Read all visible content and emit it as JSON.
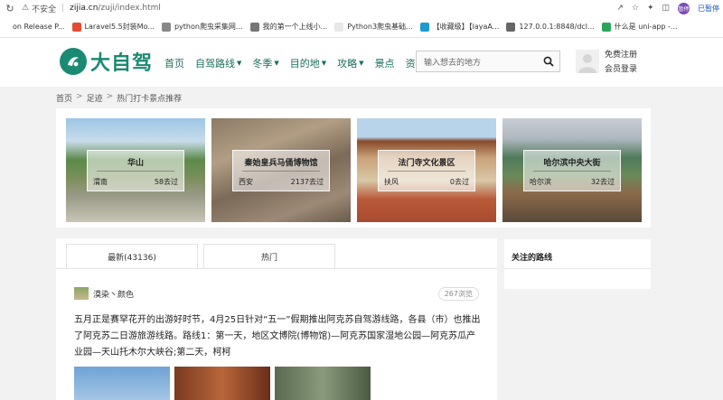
{
  "browser": {
    "security": "不安全",
    "url_host": "zijia.cn",
    "url_path": "/zuji/index.html",
    "account_label": "已暂停",
    "account_chip": "暂停"
  },
  "bookmarks": [
    {
      "label": "on Release P...",
      "color": "#ffffff"
    },
    {
      "label": "Laravel5.5封装Mo...",
      "color": "#e64a32"
    },
    {
      "label": "python爬虫采集网...",
      "color": "#888888"
    },
    {
      "label": "我的第一个上线小...",
      "color": "#777777"
    },
    {
      "label": "Python3爬虫基础...",
      "color": "#e8e8e8"
    },
    {
      "label": "【收藏级】【layaA...",
      "color": "#1d9bd1"
    },
    {
      "label": "127.0.0.1:8848/dcl...",
      "color": "#666666"
    },
    {
      "label": "什么是 uni-app -...",
      "color": "#2aa65b"
    }
  ],
  "header": {
    "logo_text": "大自驾",
    "nav": [
      {
        "label": "首页",
        "dropdown": false
      },
      {
        "label": "自驾路线",
        "dropdown": true
      },
      {
        "label": "冬季",
        "dropdown": true
      },
      {
        "label": "目的地",
        "dropdown": true
      },
      {
        "label": "攻略",
        "dropdown": true
      },
      {
        "label": "景点",
        "dropdown": false
      },
      {
        "label": "资讯",
        "dropdown": false
      }
    ],
    "search_placeholder": "输入想去的地方",
    "register": "免费注册",
    "login": "会员登录"
  },
  "breadcrumb": [
    "首页",
    "足迹",
    "热门打卡景点推荐"
  ],
  "spots": [
    {
      "name": "华山",
      "city": "渭南",
      "visits": "58去过"
    },
    {
      "name": "秦始皇兵马俑博物馆",
      "city": "西安",
      "visits": "2137去过"
    },
    {
      "name": "法门寺文化景区",
      "city": "扶风",
      "visits": "0去过"
    },
    {
      "name": "哈尔滨中央大街",
      "city": "哈尔滨",
      "visits": "32去过"
    }
  ],
  "feed": {
    "tabs": [
      "最新(43136)",
      "热门"
    ],
    "post": {
      "author": "漠染丶颜色",
      "views": "267浏览",
      "text": "五月正是赛罕花开的出游好时节，4月25日针对“五一”假期推出阿克苏自驾游线路，各县（市）也推出了阿克苏二日游旅游线路。路线1：第一天，地区文博院(博物馆)—阿克苏国家湿地公园—阿克苏瓜产业园—天山托木尔大峡谷;第二天，柯柯"
    }
  },
  "sidebar": {
    "title": "关注的路线"
  },
  "colors": {
    "brand": "#1a8a72",
    "nav_text": "#1a6e5c"
  }
}
